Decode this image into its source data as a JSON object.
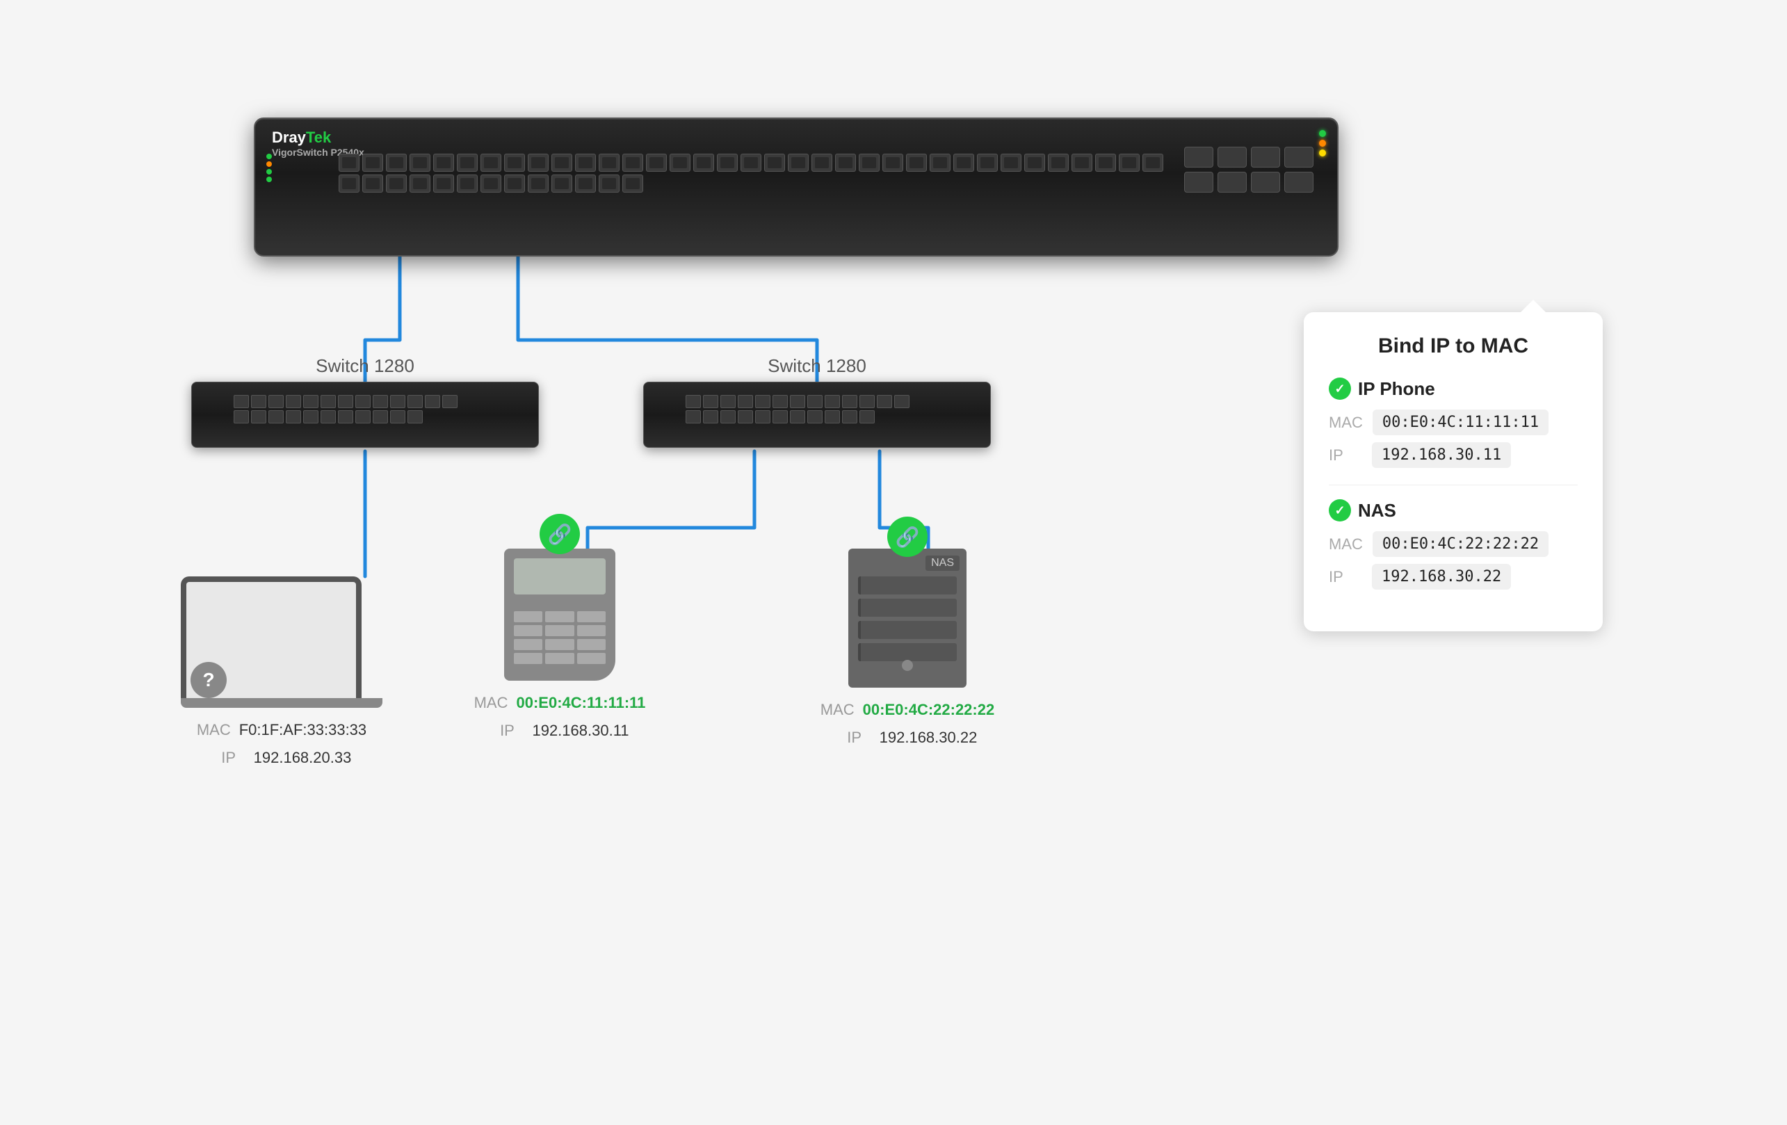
{
  "main_switch": {
    "brand_dray": "Dray",
    "brand_tek": "Tek",
    "model": "VigorSwitch P2540x"
  },
  "switch_left": {
    "label": "Switch 1280"
  },
  "switch_right": {
    "label": "Switch 1280"
  },
  "device_laptop": {
    "mac_label": "MAC",
    "mac_value": "F0:1F:AF:33:33:33",
    "ip_label": "IP",
    "ip_value": "192.168.20.33"
  },
  "device_phone": {
    "mac_label": "MAC",
    "mac_value": "00:E0:4C:11:11:11",
    "ip_label": "IP",
    "ip_value": "192.168.30.11"
  },
  "device_nas": {
    "nas_text": "NAS",
    "mac_label": "MAC",
    "mac_value": "00:E0:4C:22:22:22",
    "ip_label": "IP",
    "ip_value": "192.168.30.22"
  },
  "bind_card": {
    "title": "Bind IP to MAC",
    "section1": {
      "name": "IP Phone",
      "mac_label": "MAC",
      "mac_value": "00:E0:4C:11:11:11",
      "ip_label": "IP",
      "ip_value": "192.168.30.11"
    },
    "section2": {
      "name": "NAS",
      "mac_label": "MAC",
      "mac_value": "00:E0:4C:22:22:22",
      "ip_label": "IP",
      "ip_value": "192.168.30.22"
    }
  }
}
